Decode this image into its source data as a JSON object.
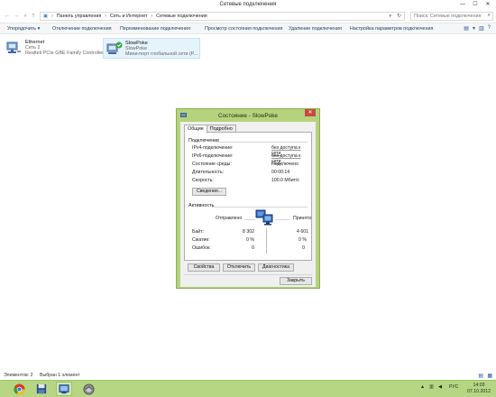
{
  "window": {
    "title": "Сетевые подключения"
  },
  "address": {
    "crumbs": [
      "Панель управления",
      "Сеть и Интернет",
      "Сетевые подключения"
    ],
    "search_placeholder": "Поиск: Сетевые подключения"
  },
  "commands": {
    "organize": "Упорядочить ▾",
    "disconnect": "Отключение подключения",
    "rename": "Переименование подключения",
    "view_status": "Просмотр состояния подключения",
    "delete": "Удаление подключения",
    "settings": "Настройка параметров подключения"
  },
  "connections": [
    {
      "name": "Ethernet",
      "line2": "Сеть 2",
      "line3": "Realtek PCIe GBE Family Controller"
    },
    {
      "name": "SlowPoke",
      "line2": "SlowPoke",
      "line3": "Мини-порт глобальной сети (P..."
    }
  ],
  "dialog": {
    "title": "Состояние - SlowPoke",
    "close": "✕",
    "tabs": [
      "Общие",
      "Подробно"
    ],
    "connection_group": "Подключение",
    "rows": [
      {
        "label": "IPv4-подключение:",
        "value": "без доступа к сети"
      },
      {
        "label": "IPv6-подключение:",
        "value": "без доступа к сети"
      },
      {
        "label": "Состояние среды:",
        "value": "Подключено"
      },
      {
        "label": "Длительность:",
        "value": "00:00:14"
      },
      {
        "label": "Скорость:",
        "value": "100.0 Мбит/с"
      }
    ],
    "details_button": "Сведения...",
    "activity_group": "Активность",
    "sent_label": "Отправлено",
    "received_label": "Принято",
    "stats": [
      {
        "label": "Байт:",
        "sent": "8 302",
        "received": "4 601"
      },
      {
        "label": "Сжатие:",
        "sent": "0 %",
        "received": "0 %"
      },
      {
        "label": "Ошибок:",
        "sent": "0",
        "received": "0"
      }
    ],
    "buttons": {
      "properties": "Свойства",
      "disconnect": "Отключить",
      "diagnose": "Диагностика",
      "close": "Закрыть"
    }
  },
  "statusbar": {
    "items": "Элементов: 2",
    "selected": "Выбран 1 элемент"
  },
  "taskbar": {
    "lang": "РУС",
    "time": "14:03",
    "date": "07.10.2012"
  },
  "colors": {
    "dialog_frame": "#b5d37c",
    "taskbar": "#b7d684",
    "close_red": "#c74b3c"
  }
}
